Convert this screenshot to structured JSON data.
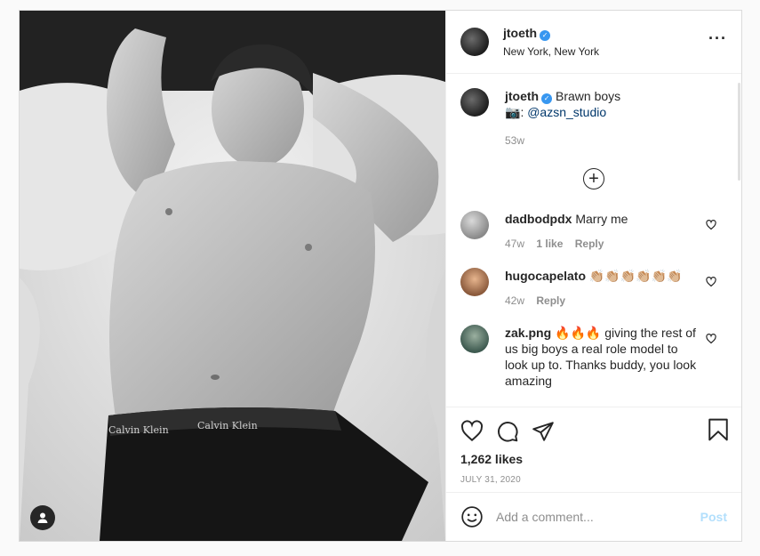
{
  "post": {
    "username": "jtoeth",
    "location": "New York, New York",
    "caption": {
      "username": "jtoeth",
      "text": "Brawn boys",
      "credit_emoji": "📷",
      "credit_sep": ":",
      "credit_handle": "@azsn_studio",
      "time": "53w"
    },
    "comments": [
      {
        "username": "dadbodpdx",
        "text": "Marry me",
        "time": "47w",
        "likes": "1 like",
        "reply": "Reply"
      },
      {
        "username": "hugocapelato",
        "text": "👏🏼👏🏼👏🏼👏🏼👏🏼👏🏼",
        "time": "42w",
        "reply": "Reply"
      },
      {
        "username": "zak.png",
        "text": "🔥🔥🔥 giving the rest of us big boys a real role model to look up to. Thanks buddy, you look amazing"
      }
    ],
    "likes_count": "1,262 likes",
    "date": "JULY 31, 2020",
    "add_comment_placeholder": "Add a comment...",
    "post_label": "Post",
    "photo_text": {
      "waistband_left": "Calvin Klein",
      "waistband_center": "Calvin Klein"
    }
  },
  "colors": {
    "verified": "#3897f0",
    "link": "#00376b",
    "post_button": "#b2dffc",
    "muted": "#8e8e8e"
  },
  "icons": [
    "user-tag-icon",
    "more-icon",
    "verified-icon",
    "plus-circle-icon",
    "heart-icon",
    "comment-icon",
    "share-icon",
    "bookmark-icon",
    "emoji-icon"
  ]
}
